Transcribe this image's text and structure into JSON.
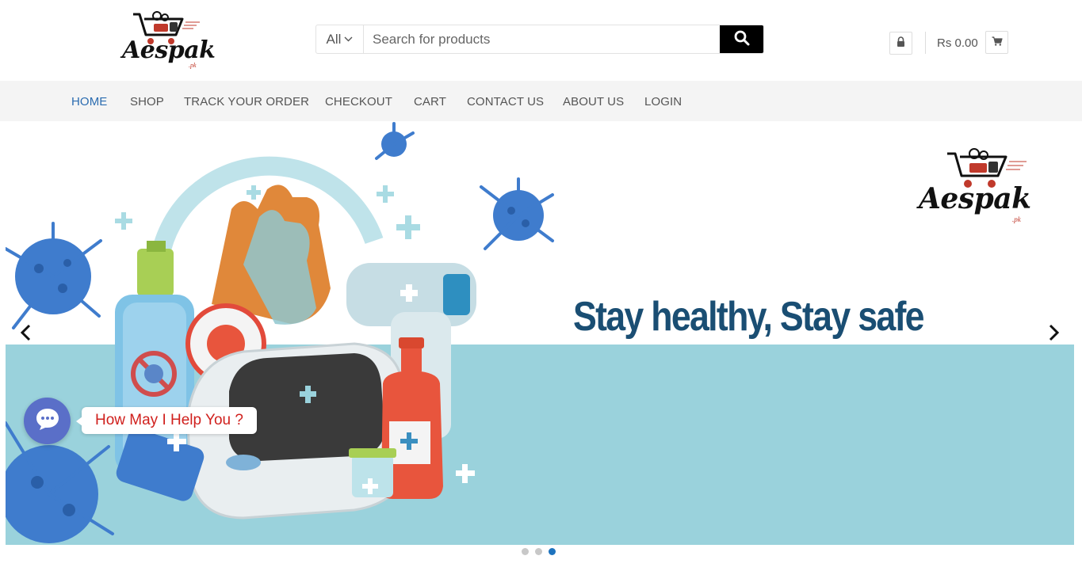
{
  "header": {
    "logo_text": "Aespak",
    "logo_suffix": ".pk",
    "search": {
      "category": "All",
      "placeholder": "Search for products"
    },
    "cart_total": "Rs 0.00",
    "icons": {
      "search": "search-icon",
      "lock": "lock-icon",
      "cart": "cart-icon",
      "dropdown": "chevron-down-icon"
    }
  },
  "nav": {
    "items": [
      {
        "label": "HOME",
        "active": true
      },
      {
        "label": "SHOP"
      },
      {
        "label": "TRACK YOUR ORDER"
      },
      {
        "label": "CHECKOUT"
      },
      {
        "label": "CART"
      },
      {
        "label": "CONTACT US"
      },
      {
        "label": "ABOUT US"
      },
      {
        "label": "LOGIN"
      }
    ]
  },
  "hero": {
    "title": "Stay healthy, Stay safe",
    "logo_text": "Aespak",
    "logo_suffix": ".pk",
    "slide_index": 3,
    "slide_count": 3
  },
  "chat": {
    "label": "How May I Help You ?"
  },
  "colors": {
    "nav_active": "#2b6cb0",
    "hero_title": "#1a4e73",
    "hero_band": "#9ad2dc",
    "chat_bubble": "#5a6fc8",
    "chat_text": "#d0201d",
    "dot_active": "#1e73be"
  }
}
